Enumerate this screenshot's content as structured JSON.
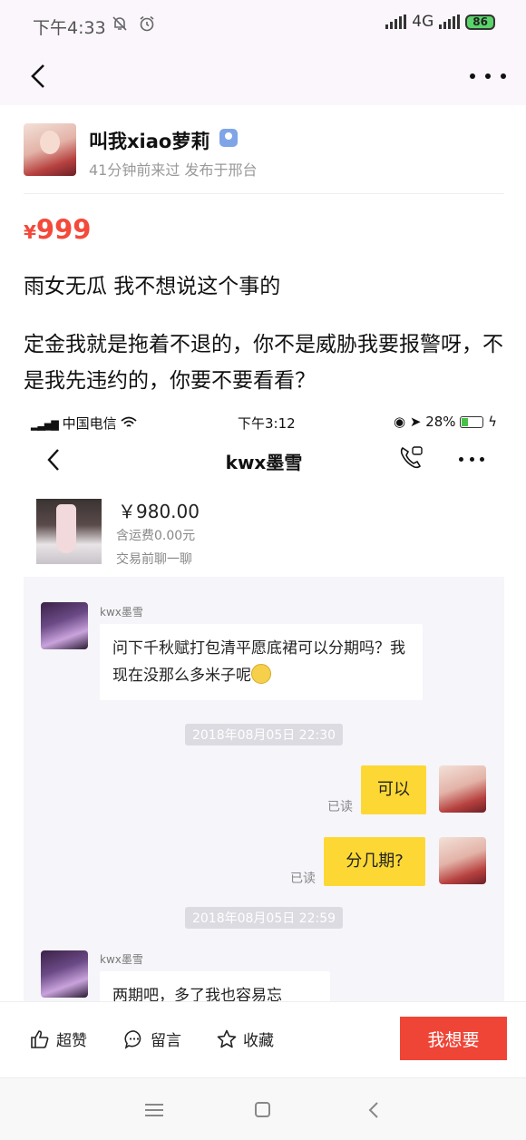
{
  "status_bar": {
    "time": "下午4:33",
    "network": "4G",
    "battery": "86"
  },
  "seller": {
    "name": "叫我xiao萝莉",
    "meta": "41分钟前来过 发布于邢台"
  },
  "listing": {
    "currency": "¥",
    "price": "999",
    "line1": "雨女无瓜 我不想说这个事的",
    "line2": "定金我就是拖着不退的，你不是威胁我要报警呀，不是我先违约的，你要不要看看？"
  },
  "embedded_screenshot": {
    "status": {
      "carrier": "中国电信",
      "time": "下午3:12",
      "battery": "28%"
    },
    "chat_title": "kwx墨雪",
    "product": {
      "price": "￥980.00",
      "shipping": "含运费0.00元",
      "hint": "交易前聊一聊"
    },
    "messages": [
      {
        "sender": "kwx墨雪",
        "text": "问下千秋赋打包清平愿底裙可以分期吗？我现在没那么多米子呢"
      },
      {
        "timestamp": "2018年08月05日 22:30"
      },
      {
        "sender": "me",
        "text": "可以",
        "status": "已读"
      },
      {
        "sender": "me",
        "text": "分几期?",
        "status": "已读"
      },
      {
        "timestamp": "2018年08月05日 22:59"
      },
      {
        "sender": "kwx墨雪",
        "text": "两期吧，多了我也容易忘"
      }
    ]
  },
  "actions": {
    "like": "超赞",
    "comment": "留言",
    "favorite": "收藏",
    "want": "我想要"
  },
  "colors": {
    "price_red": "#f34a3a",
    "want_button": "#ef4537",
    "my_bubble": "#fdd835"
  }
}
